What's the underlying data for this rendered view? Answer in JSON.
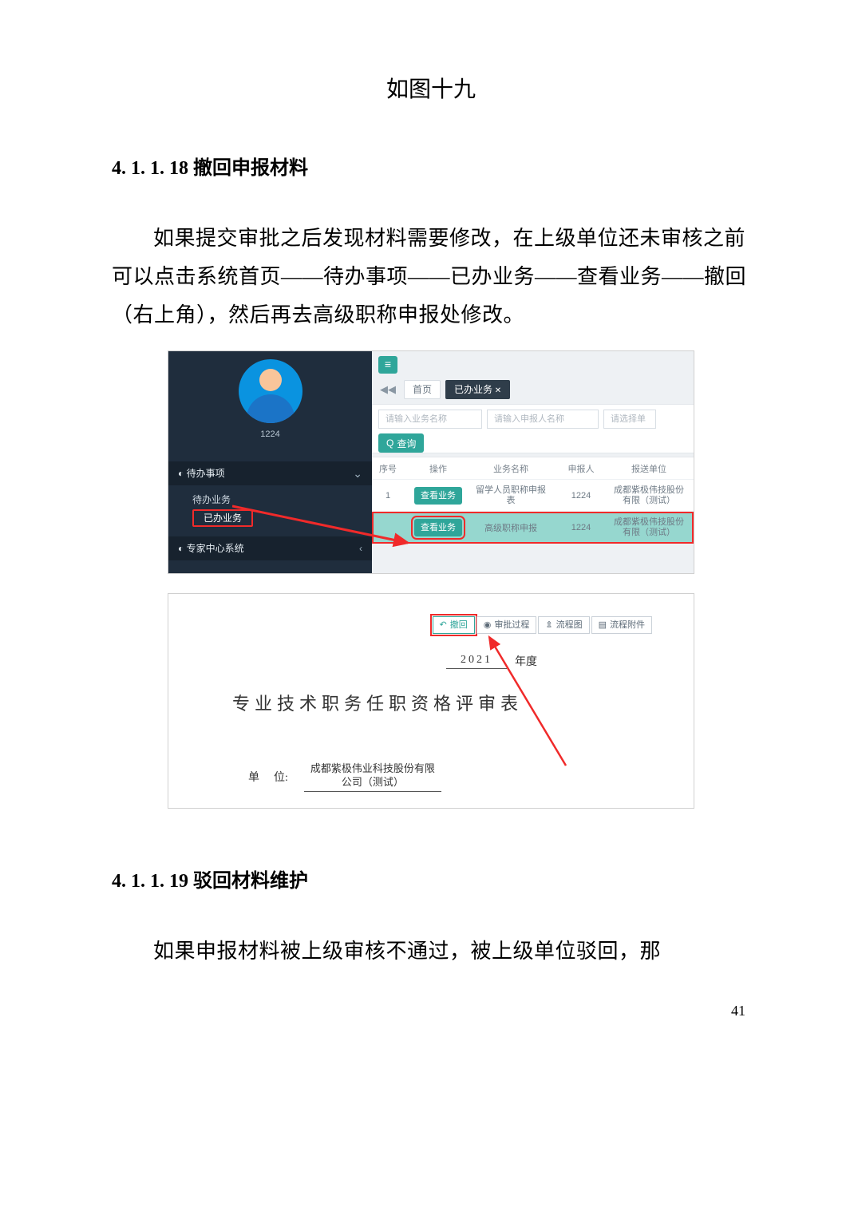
{
  "figure_caption": "如图十九",
  "section_a": {
    "num": "4. 1. 1. 18 ",
    "title": "撤回申报材料"
  },
  "para_a": "如果提交审批之后发现材料需要修改，在上级单位还未审核之前可以点击系统首页——待办事项——已办业务——查看业务——撤回（右上角），然后再去高级职称申报处修改。",
  "section_b": {
    "num": "4. 1. 1. 19 ",
    "title": "驳回材料维护"
  },
  "para_b": "如果申报材料被上级审核不通过，被上级单位驳回，那",
  "page_number": "41",
  "app": {
    "username": "1224",
    "menu": {
      "todo": "待办事项",
      "pending": "待办业务",
      "done": "已办业务",
      "expert": "专家中心系统"
    },
    "hamburger": "≡",
    "tabs": {
      "home": "首页",
      "done": "已办业务"
    },
    "filters": {
      "biz_name": "请输入业务名称",
      "applicant": "请输入申报人名称",
      "unit": "请选择单",
      "query": "查询"
    },
    "grid": {
      "headers": {
        "idx": "序号",
        "op": "操作",
        "biz": "业务名称",
        "applicant": "申报人",
        "unit": "报送单位"
      },
      "view_btn": "查看业务",
      "rows": [
        {
          "idx": "1",
          "biz": "留学人员职称申报表",
          "applicant": "1224",
          "unit": "成都紫极伟技股份有限（测试）"
        },
        {
          "idx": "",
          "biz": "高级职称申报",
          "applicant": "1224",
          "unit": "成都紫极伟技股份有限（测试）"
        }
      ]
    }
  },
  "detail": {
    "actions": {
      "recall": "撤回",
      "process": "审批过程",
      "flowchart": "流程图",
      "attach": "流程附件"
    },
    "year": "2021",
    "year_suffix": "年度",
    "title": "专业技术职务任职资格评审表",
    "unit_label": "单",
    "unit_label2": "位:",
    "unit_value_l1": "成都紫极伟业科技股份有限",
    "unit_value_l2": "公司（测试）"
  },
  "icons": {
    "half": "◐",
    "search": "Q",
    "eye": "◉",
    "chart": "⇭",
    "doc": "▤",
    "recall": "↶"
  }
}
